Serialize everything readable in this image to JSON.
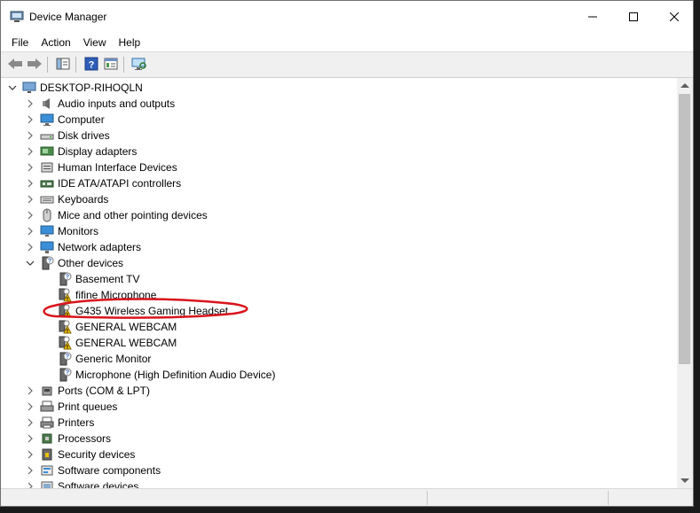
{
  "window": {
    "title": "Device Manager"
  },
  "menu": {
    "items": [
      "File",
      "Action",
      "View",
      "Help"
    ]
  },
  "tree": {
    "root": "DESKTOP-RIHOQLN",
    "items": [
      {
        "label": "Audio inputs and outputs",
        "icon": "speaker-icon",
        "expanded": false,
        "level": 1
      },
      {
        "label": "Computer",
        "icon": "computer-icon",
        "expanded": false,
        "level": 1
      },
      {
        "label": "Disk drives",
        "icon": "disk-drive-icon",
        "expanded": false,
        "level": 1
      },
      {
        "label": "Display adapters",
        "icon": "display-adapter-icon",
        "expanded": false,
        "level": 1
      },
      {
        "label": "Human Interface Devices",
        "icon": "hid-icon",
        "expanded": false,
        "level": 1
      },
      {
        "label": "IDE ATA/ATAPI controllers",
        "icon": "ide-controller-icon",
        "expanded": false,
        "level": 1
      },
      {
        "label": "Keyboards",
        "icon": "keyboard-icon",
        "expanded": false,
        "level": 1
      },
      {
        "label": "Mice and other pointing devices",
        "icon": "mouse-icon",
        "expanded": false,
        "level": 1
      },
      {
        "label": "Monitors",
        "icon": "monitor-icon",
        "expanded": false,
        "level": 1
      },
      {
        "label": "Network adapters",
        "icon": "network-adapter-icon",
        "expanded": false,
        "level": 1
      },
      {
        "label": "Other devices",
        "icon": "unknown-device-icon",
        "expanded": true,
        "level": 1
      },
      {
        "label": "Basement TV",
        "icon": "unknown-device-icon",
        "level": 2
      },
      {
        "label": "fifine Microphone",
        "icon": "warning-device-icon",
        "level": 2
      },
      {
        "label": "G435 Wireless Gaming Headset",
        "icon": "warning-device-icon",
        "level": 2,
        "highlighted": true
      },
      {
        "label": "GENERAL WEBCAM",
        "icon": "warning-device-icon",
        "level": 2
      },
      {
        "label": "GENERAL WEBCAM",
        "icon": "warning-device-icon",
        "level": 2
      },
      {
        "label": "Generic Monitor",
        "icon": "unknown-device-icon",
        "level": 2
      },
      {
        "label": "Microphone (High Definition Audio Device)",
        "icon": "unknown-device-icon",
        "level": 2
      },
      {
        "label": "Ports (COM & LPT)",
        "icon": "port-icon",
        "expanded": false,
        "level": 1
      },
      {
        "label": "Print queues",
        "icon": "print-queue-icon",
        "expanded": false,
        "level": 1
      },
      {
        "label": "Printers",
        "icon": "printer-icon",
        "expanded": false,
        "level": 1
      },
      {
        "label": "Processors",
        "icon": "processor-icon",
        "expanded": false,
        "level": 1
      },
      {
        "label": "Security devices",
        "icon": "security-icon",
        "expanded": false,
        "level": 1
      },
      {
        "label": "Software components",
        "icon": "software-component-icon",
        "expanded": false,
        "level": 1
      },
      {
        "label": "Software devices",
        "icon": "software-device-icon",
        "expanded": false,
        "level": 1
      }
    ]
  },
  "colors": {
    "annotation": "#d9141c",
    "accent": "#2f7fd1"
  }
}
